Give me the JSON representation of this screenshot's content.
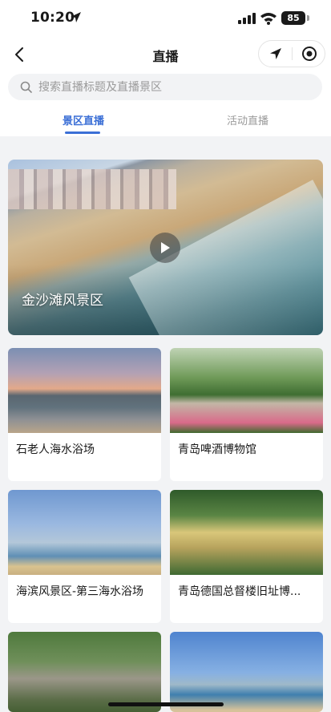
{
  "status_bar": {
    "time": "10:20",
    "battery": "85"
  },
  "nav": {
    "title": "直播"
  },
  "search": {
    "placeholder": "搜索直播标题及直播景区"
  },
  "tabs": [
    {
      "label": "景区直播",
      "active": true
    },
    {
      "label": "活动直播",
      "active": false
    }
  ],
  "featured": {
    "title": "金沙滩风景区"
  },
  "cards": [
    {
      "title": "石老人海水浴场"
    },
    {
      "title": "青岛啤酒博物馆"
    },
    {
      "title": "海滨风景区-第三海水浴场"
    },
    {
      "title": "青岛德国总督楼旧址博..."
    },
    {
      "title": ""
    },
    {
      "title": ""
    }
  ],
  "colors": {
    "accent": "#3b6fd6",
    "background": "#f2f3f5"
  }
}
